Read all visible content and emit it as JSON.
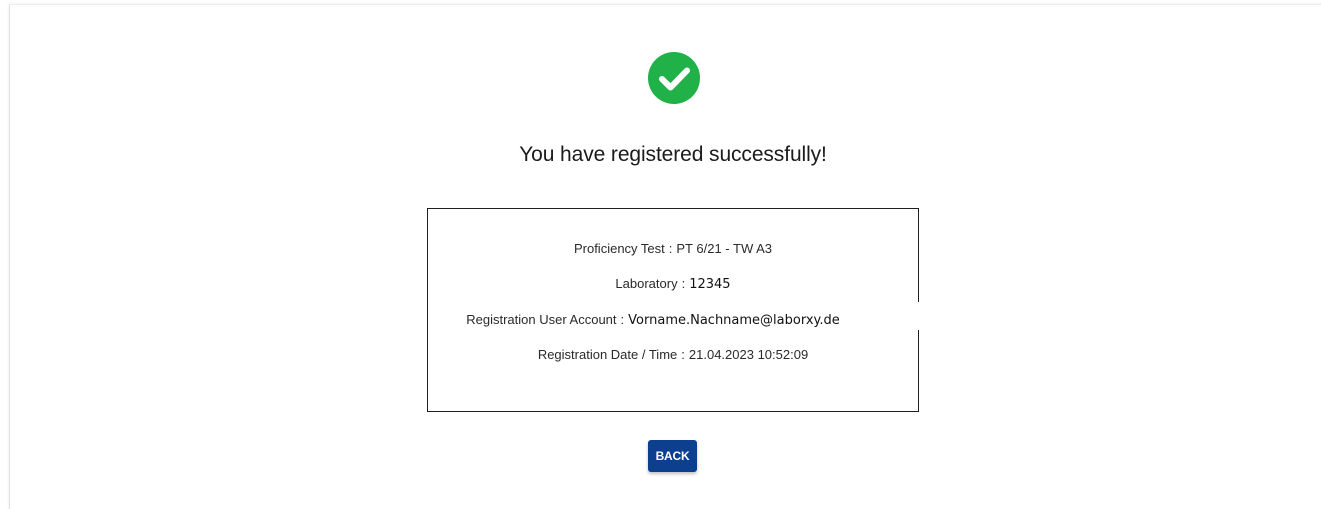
{
  "status": {
    "icon": "check-circle-icon",
    "icon_color": "#20b149",
    "message": "You have registered successfully!"
  },
  "details": {
    "proficiency_test": {
      "label": "Proficiency Test",
      "value": "PT 6/21 - TW A3"
    },
    "laboratory": {
      "label": "Laboratory",
      "value": "12345"
    },
    "user_account": {
      "label": "Registration User Account",
      "value": "Vorname.Nachname@laborxy.de"
    },
    "date_time": {
      "label": "Registration Date / Time",
      "value": "21.04.2023 10:52:09"
    }
  },
  "actions": {
    "back_label": "BACK",
    "back_color": "#0d3f8f"
  }
}
